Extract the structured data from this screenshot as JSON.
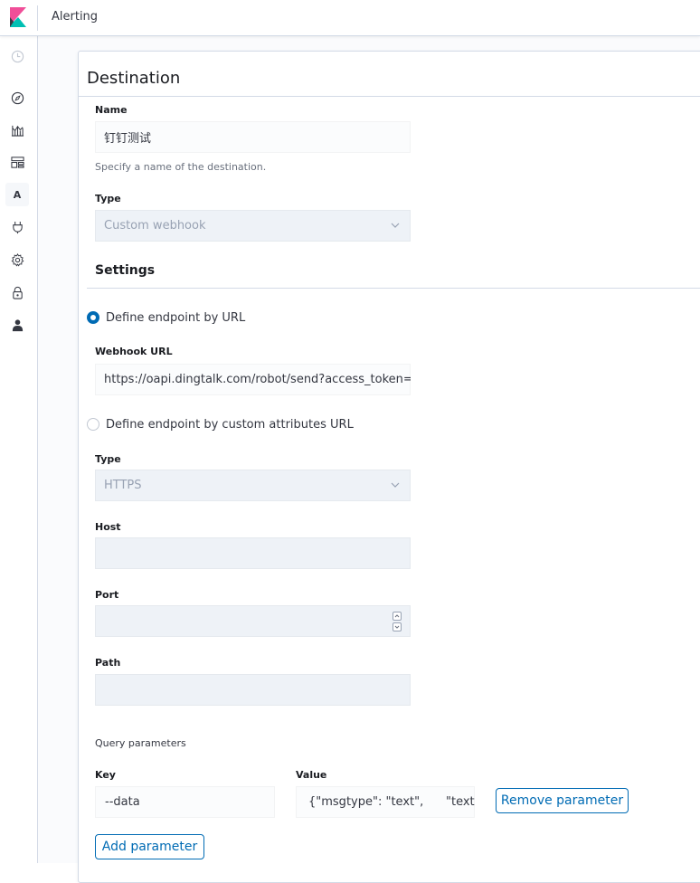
{
  "app": {
    "title": "Alerting"
  },
  "nav": {
    "items": [
      {
        "name": "recent-icon"
      },
      {
        "name": "discover-icon"
      },
      {
        "name": "visualize-icon"
      },
      {
        "name": "dashboard-icon"
      },
      {
        "name": "alerting-icon",
        "letter": "A"
      },
      {
        "name": "dev-tools-icon"
      },
      {
        "name": "management-icon"
      },
      {
        "name": "security-icon"
      },
      {
        "name": "user-icon"
      }
    ]
  },
  "destination": {
    "title": "Destination",
    "name_label": "Name",
    "name_value": "钉钉测试",
    "name_help": "Specify a name of the destination.",
    "type_label": "Type",
    "type_value": "Custom webhook"
  },
  "settings": {
    "title": "Settings",
    "radio_url_label": "Define endpoint by URL",
    "webhook_url_label": "Webhook URL",
    "webhook_url_value": "https://oapi.dingtalk.com/robot/send?access_token=",
    "radio_custom_label": "Define endpoint by custom attributes URL",
    "type_label": "Type",
    "type_value": "HTTPS",
    "host_label": "Host",
    "port_label": "Port",
    "path_label": "Path",
    "query_params_label": "Query parameters",
    "key_label": "Key",
    "value_label": "Value",
    "key_value": "--data",
    "value_value": "{\"msgtype\": \"text\",      \"text\":",
    "remove_button": "Remove parameter",
    "add_button": "Add parameter"
  },
  "colors": {
    "accent": "#006bb4",
    "border": "#d3dae6",
    "field_bg": "#fbfcfd"
  }
}
